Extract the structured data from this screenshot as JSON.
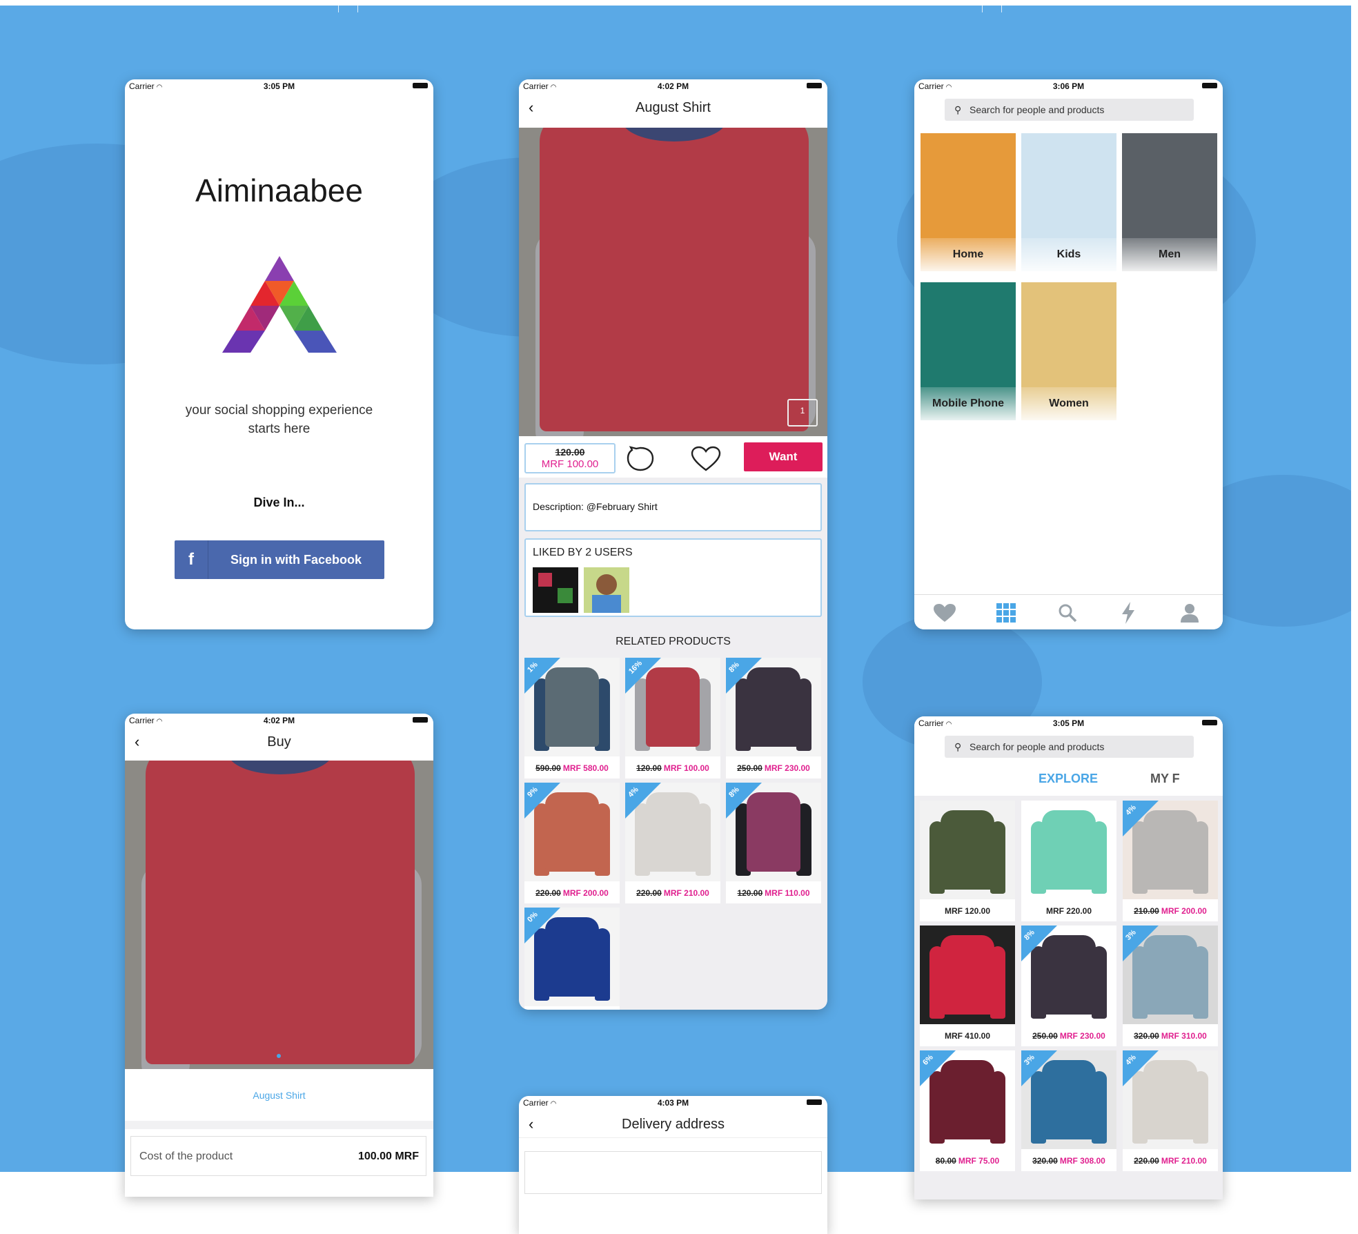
{
  "colors": {
    "accent_pink": "#e0208f",
    "facebook_blue": "#4a68ad",
    "badge_blue": "#4aa6e6",
    "background_blue": "#5aa9e6"
  },
  "screens": {
    "welcome": {
      "status": {
        "carrier": "Carrier",
        "time": "3:05 PM"
      },
      "app_name": "Aiminaabee",
      "tagline_line1": "your social shopping experience",
      "tagline_line2": "starts here",
      "dive_in": "Dive In...",
      "facebook_icon": "f",
      "facebook_button": "Sign in with Facebook"
    },
    "product": {
      "status": {
        "carrier": "Carrier",
        "time": "4:02 PM"
      },
      "title": "August Shirt",
      "image_counter": "1",
      "old_price": "120.00",
      "new_price": "MRF 100.00",
      "want_button": "Want",
      "description": "Description: @February Shirt",
      "liked_by": "LIKED BY 2 USERS",
      "related_header": "RELATED PRODUCTS",
      "related": [
        {
          "badge": "1%",
          "old": "590.00",
          "new": "MRF 580.00",
          "color": "#5b6b74",
          "sleeve": "#2d4a6b"
        },
        {
          "badge": "16%",
          "old": "120.00",
          "new": "MRF 100.00",
          "color": "#b23b47",
          "sleeve": "#a4a4a8"
        },
        {
          "badge": "8%",
          "old": "250.00",
          "new": "MRF 230.00",
          "color": "#3a3340",
          "sleeve": "#3a3340"
        },
        {
          "badge": "9%",
          "old": "220.00",
          "new": "MRF 200.00",
          "color": "#c2654f",
          "sleeve": "#c2654f"
        },
        {
          "badge": "4%",
          "old": "220.00",
          "new": "MRF 210.00",
          "color": "#d9d6d2",
          "sleeve": "#d9d6d2"
        },
        {
          "badge": "8%",
          "old": "120.00",
          "new": "MRF 110.00",
          "color": "#8a3a62",
          "sleeve": "#1f1f24"
        },
        {
          "badge": "0%",
          "old": "",
          "new": "",
          "color": "#1c3b8f",
          "sleeve": "#1c3b8f"
        }
      ]
    },
    "categories": {
      "status": {
        "carrier": "Carrier",
        "time": "3:06 PM"
      },
      "search_placeholder": "Search for people and products",
      "tiles": [
        {
          "label": "Home",
          "color": "#e69a3a"
        },
        {
          "label": "Kids",
          "color": "#cfe3f0"
        },
        {
          "label": "Men",
          "color": "#5a6066"
        },
        {
          "label": "Mobile Phone",
          "color": "#1f7a6e"
        },
        {
          "label": "Women",
          "color": "#e3c27a"
        }
      ],
      "tabbar_icons": [
        "heart-icon",
        "grid-icon",
        "search-icon",
        "lightning-icon",
        "person-icon"
      ]
    },
    "buy": {
      "status": {
        "carrier": "Carrier",
        "time": "4:02 PM"
      },
      "title": "Buy",
      "product_name": "August Shirt",
      "cost_label": "Cost of the product",
      "cost_value": "100.00 MRF"
    },
    "delivery": {
      "status": {
        "carrier": "Carrier",
        "time": "4:03 PM"
      },
      "title": "Delivery address"
    },
    "explore": {
      "status": {
        "carrier": "Carrier",
        "time": "3:05 PM"
      },
      "search_placeholder": "Search for people and products",
      "tab_explore": "EXPLORE",
      "tab_my": "MY F",
      "products": [
        {
          "badge": "",
          "old": "",
          "new": "MRF 120.00",
          "color": "#4b5a3a",
          "bg": "#f2f2f2",
          "black_price": true
        },
        {
          "badge": "",
          "old": "",
          "new": "MRF 220.00",
          "color": "#6fd0b5",
          "bg": "#ffffff",
          "black_price": true
        },
        {
          "badge": "4%",
          "old": "210.00",
          "new": "MRF 200.00",
          "color": "#b9b7b5",
          "bg": "#efe6e0",
          "black_price": false
        },
        {
          "badge": "",
          "old": "",
          "new": "MRF 410.00",
          "color": "#d0243f",
          "bg": "#222222",
          "black_price": true
        },
        {
          "badge": "8%",
          "old": "250.00",
          "new": "MRF 230.00",
          "color": "#3a3340",
          "bg": "#ffffff",
          "black_price": false
        },
        {
          "badge": "3%",
          "old": "320.00",
          "new": "MRF 310.00",
          "color": "#8aa7b8",
          "bg": "#d8d8d8",
          "black_price": false
        },
        {
          "badge": "6%",
          "old": "80.00",
          "new": "MRF 75.00",
          "color": "#6b1f2f",
          "bg": "#ffffff",
          "black_price": false
        },
        {
          "badge": "3%",
          "old": "320.00",
          "new": "MRF 308.00",
          "color": "#2e6f9e",
          "bg": "#e6e6e6",
          "black_price": false
        },
        {
          "badge": "4%",
          "old": "220.00",
          "new": "MRF 210.00",
          "color": "#d8d4ce",
          "bg": "#f2f2f2",
          "black_price": false
        }
      ]
    }
  }
}
